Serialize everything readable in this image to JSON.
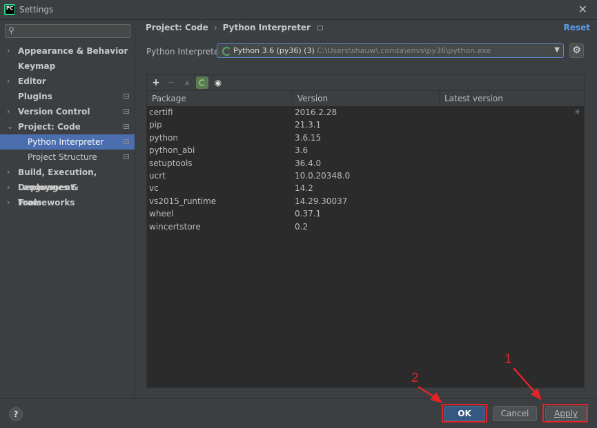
{
  "window": {
    "title": "Settings",
    "app_icon_text": "PC"
  },
  "sidebar": {
    "search_placeholder": "",
    "items": [
      {
        "label": "Appearance & Behavior",
        "arrow": "›",
        "has_icon": false
      },
      {
        "label": "Keymap",
        "arrow": "",
        "has_icon": false
      },
      {
        "label": "Editor",
        "arrow": "›",
        "has_icon": false
      },
      {
        "label": "Plugins",
        "arrow": "",
        "has_icon": true
      },
      {
        "label": "Version Control",
        "arrow": "›",
        "has_icon": true
      },
      {
        "label": "Project: Code",
        "arrow": "⌄",
        "has_icon": true
      },
      {
        "label": "Python Interpreter",
        "arrow": "",
        "has_icon": true,
        "selected": true
      },
      {
        "label": "Project Structure",
        "arrow": "",
        "has_icon": true
      },
      {
        "label": "Build, Execution, Deployment",
        "arrow": "›",
        "has_icon": false
      },
      {
        "label": "Languages & Frameworks",
        "arrow": "›",
        "has_icon": false
      },
      {
        "label": "Tools",
        "arrow": "›",
        "has_icon": false
      }
    ]
  },
  "breadcrumb": {
    "parent": "Project: Code",
    "separator": "›",
    "current": "Python Interpreter"
  },
  "reset_label": "Reset",
  "interpreter": {
    "label": "Python Interpreter:",
    "name": "Python 3.6 (py36) (3)",
    "path": "C:\\Users\\shauw\\.conda\\envs\\py36\\python.exe"
  },
  "toolbar": {
    "add": "+",
    "remove": "−",
    "up": "▲",
    "eye": "👁"
  },
  "table": {
    "columns": [
      "Package",
      "Version",
      "Latest version"
    ],
    "rows": [
      {
        "package": "certifi",
        "version": "2016.2.28"
      },
      {
        "package": "pip",
        "version": "21.3.1"
      },
      {
        "package": "python",
        "version": "3.6.15"
      },
      {
        "package": "python_abi",
        "version": "3.6"
      },
      {
        "package": "setuptools",
        "version": "36.4.0"
      },
      {
        "package": "ucrt",
        "version": "10.0.20348.0"
      },
      {
        "package": "vc",
        "version": "14.2"
      },
      {
        "package": "vs2015_runtime",
        "version": "14.29.30037"
      },
      {
        "package": "wheel",
        "version": "0.37.1"
      },
      {
        "package": "wincertstore",
        "version": "0.2"
      }
    ]
  },
  "footer": {
    "help": "?",
    "ok": "OK",
    "cancel": "Cancel",
    "apply": "Apply"
  },
  "annotations": {
    "apply_step": "1",
    "ok_step": "2",
    "color": "#e0242a"
  }
}
